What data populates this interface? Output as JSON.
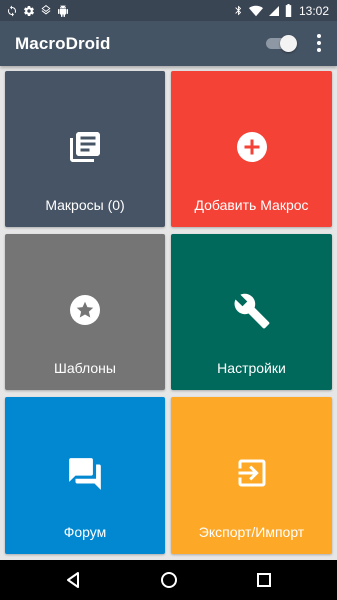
{
  "status_bar": {
    "time": "13:02",
    "left_icons": [
      "settings-sync-icon",
      "gear-icon",
      "layers-icon",
      "android-icon"
    ],
    "right_icons": [
      "bluetooth-icon",
      "wifi-icon",
      "signal-icon",
      "battery-icon"
    ]
  },
  "app_bar": {
    "title": "MacroDroid",
    "toggle_on": true
  },
  "tiles": [
    {
      "label": "Макросы (0)",
      "icon": "macro-list-icon",
      "color": "#465465"
    },
    {
      "label": "Добавить Макрос",
      "icon": "add-circle-icon",
      "color": "#f44236"
    },
    {
      "label": "Шаблоны",
      "icon": "star-circle-icon",
      "color": "#757575"
    },
    {
      "label": "Настройки",
      "icon": "wrench-icon",
      "color": "#00695b"
    },
    {
      "label": "Форум",
      "icon": "forum-icon",
      "color": "#0288d1"
    },
    {
      "label": "Экспорт/Импорт",
      "icon": "import-export-icon",
      "color": "#fea827"
    }
  ],
  "nav_bar": {
    "buttons": [
      "back-icon",
      "home-icon",
      "recents-icon"
    ]
  }
}
